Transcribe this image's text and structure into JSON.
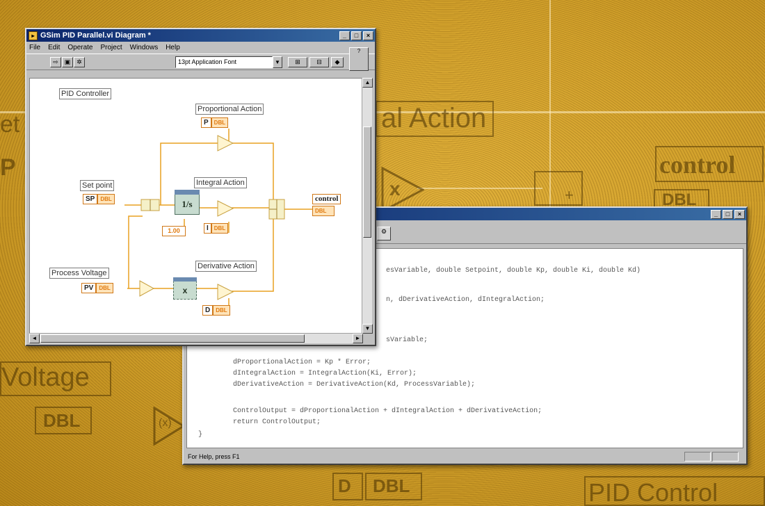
{
  "background": {
    "ghost_texts": [
      "al Action",
      "control",
      "Voltage",
      "PID Control",
      "et",
      "P",
      "DBL",
      "D",
      "DBL",
      "DBL",
      "x",
      "+",
      "(x)"
    ]
  },
  "lv_window": {
    "title": "GSim PID Parallel.vi Diagram *",
    "menu": [
      "File",
      "Edit",
      "Operate",
      "Project",
      "Windows",
      "Help"
    ],
    "font_select": "13pt Application Font",
    "diagram": {
      "caption": "PID Controller",
      "labels": {
        "proportional": "Proportional Action",
        "setpoint": "Set point",
        "integral": "Integral Action",
        "process": "Process Voltage",
        "derivative": "Derivative Action"
      },
      "terminals": {
        "p": {
          "name": "P",
          "type": "DBL"
        },
        "sp": {
          "name": "SP",
          "type": "DBL"
        },
        "i": {
          "name": "I",
          "type": "DBL"
        },
        "pv": {
          "name": "PV",
          "type": "DBL"
        },
        "d": {
          "name": "D",
          "type": "DBL"
        },
        "control": {
          "name": "control",
          "type": "DBL"
        }
      },
      "const_value": "1.00",
      "integrator": "1/s",
      "derivative_node": "x"
    }
  },
  "code_window": {
    "code_lines": [
      "esVariable, double Setpoint, double Kp, double Ki, double Kd)",
      "",
      "n, dDerivativeAction, dIntegralAction;",
      "",
      "",
      "sVariable;",
      "",
      "dProportionalAction = Kp * Error;",
      "dIntegralAction = IntegralAction(Ki, Error);",
      "dDerivativeAction = DerivativeAction(Kd, ProcessVariable);",
      "",
      "ControlOutput = dProportionalAction + dIntegralAction + dDerivativeAction;",
      "return ControlOutput;",
      "}"
    ],
    "status_text": "For Help, press F1"
  },
  "colors": {
    "wire": "#e8a020",
    "titlebar": "#0a246a"
  }
}
